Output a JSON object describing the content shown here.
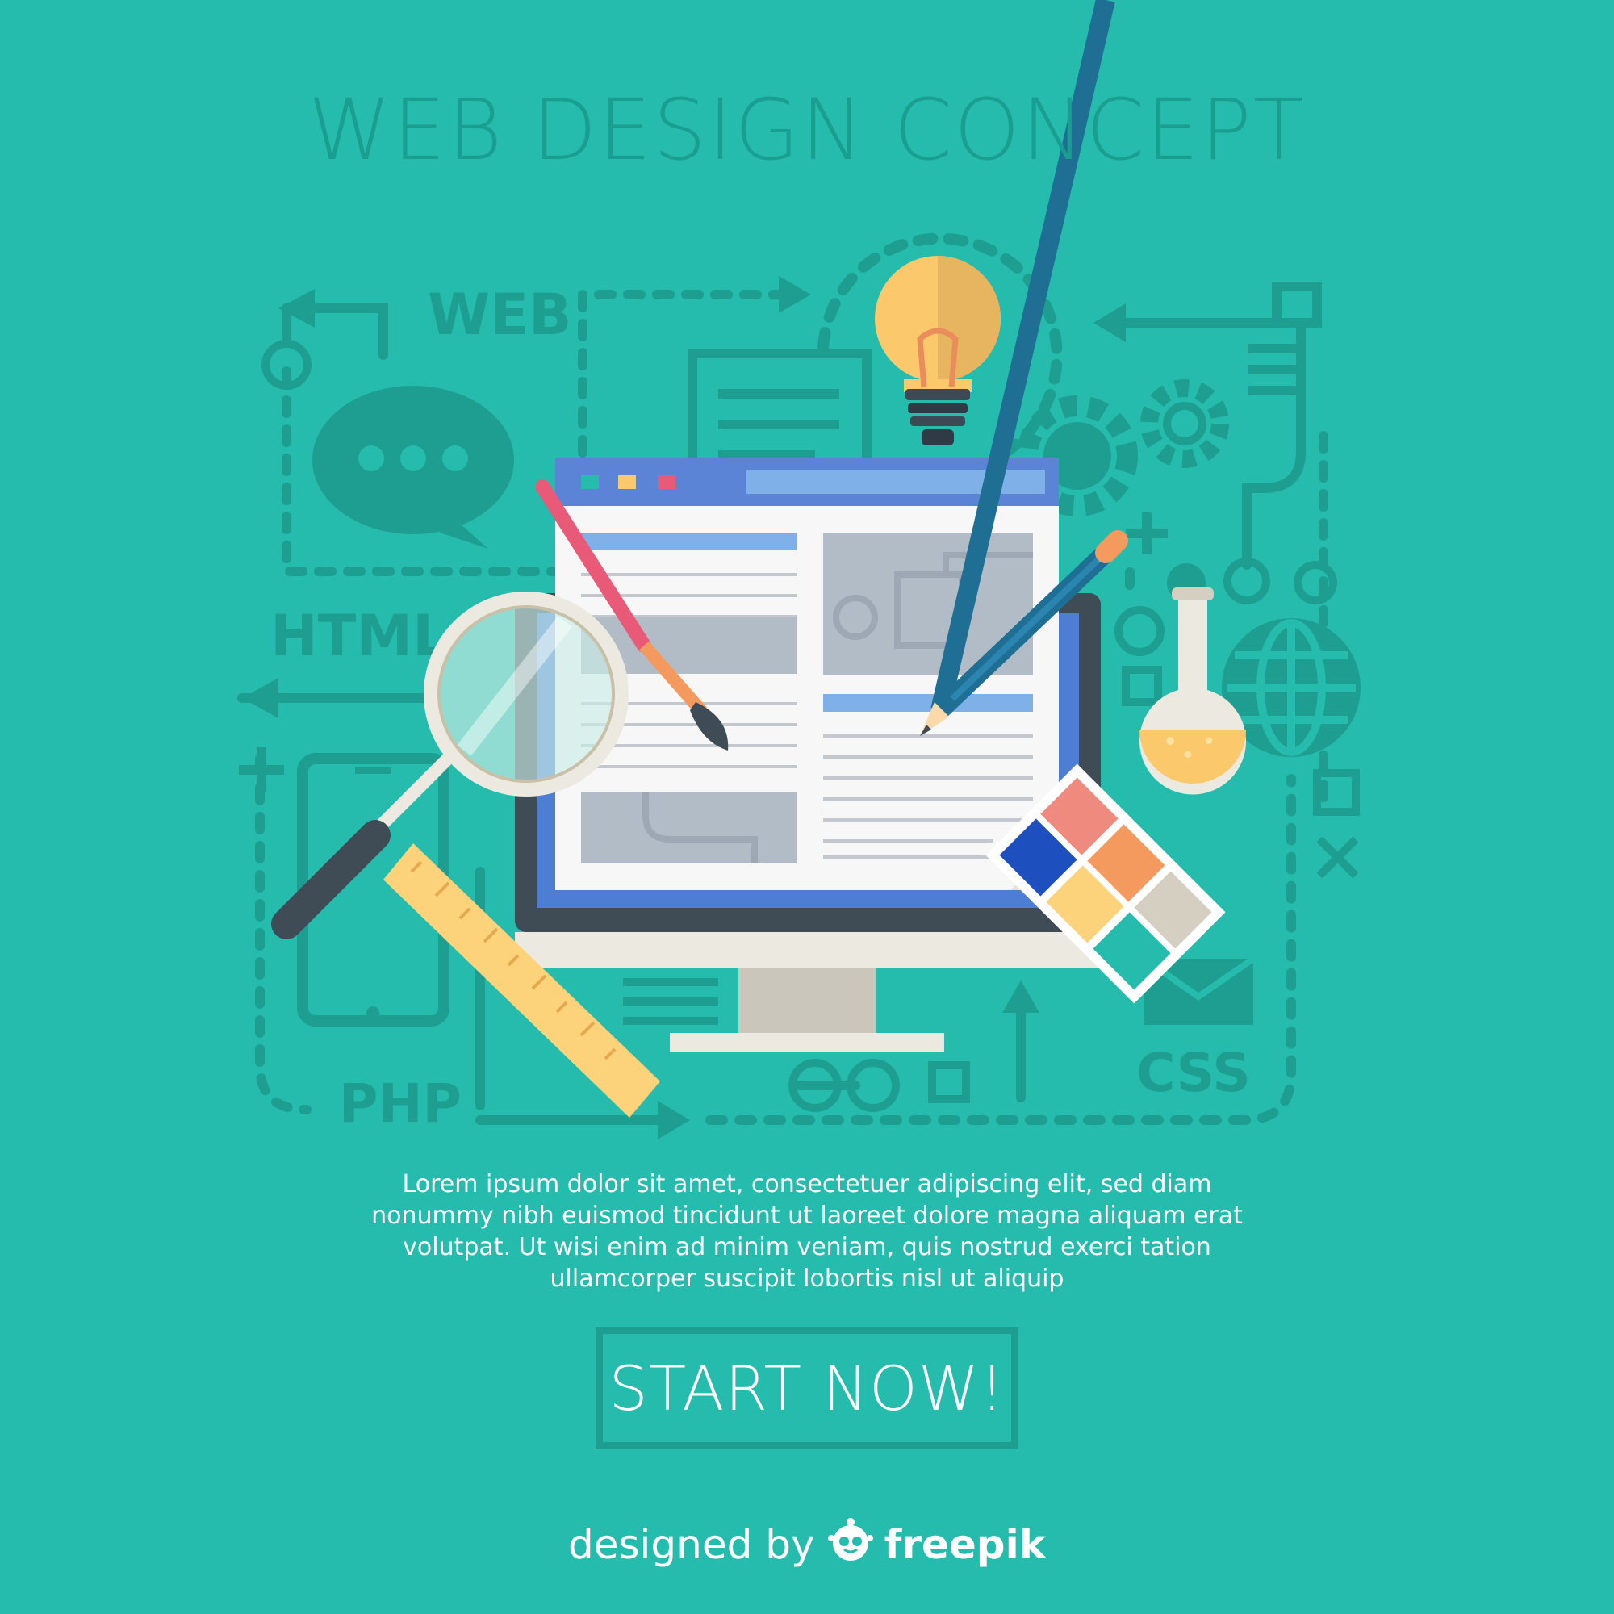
{
  "header": {
    "title": "WEB DESIGN CONCEPT"
  },
  "background_words": {
    "web": "WEB",
    "html": "HTML",
    "php": "PHP",
    "css": "CSS"
  },
  "main": {
    "body_text": "Lorem ipsum dolor sit amet, consectetuer adipiscing elit, sed diam nonummy nibh euismod tincidunt ut laoreet dolore magna aliquam erat volutpat. Ut wisi enim ad minim veniam, quis nostrud exerci tation ullamcorper suscipit lobortis nisl ut aliquip",
    "cta_label": "START NOW!"
  },
  "footer": {
    "credit_prefix": "designed by",
    "credit_brand": "freepik"
  },
  "icons": [
    "lightbulb-icon",
    "magnifier-icon",
    "paintbrush-icon",
    "pencil-icon",
    "ruler-icon",
    "flask-icon",
    "color-palette-icon",
    "globe-icon",
    "gear-icon",
    "chat-bubble-icon",
    "smartphone-icon",
    "document-icon",
    "envelope-icon",
    "freepik-logo-icon"
  ],
  "colors": {
    "background": "#25bcad",
    "outline": "#1d9e91",
    "browser_bar": "#5b84d6",
    "screen_blue": "#4e7ed3",
    "monitor_dark": "#3f4b55",
    "bulb_yellow": "#fbc96b",
    "brush_pink": "#e95a78",
    "pencil_blue": "#1f6f95",
    "ruler_yellow": "#fcd27a",
    "swatch_blue": "#1d4fbe",
    "swatch_salmon": "#ef8a7e",
    "swatch_orange": "#f59a5f",
    "swatch_gray": "#d4cfc0",
    "text_white": "#ffffff"
  }
}
